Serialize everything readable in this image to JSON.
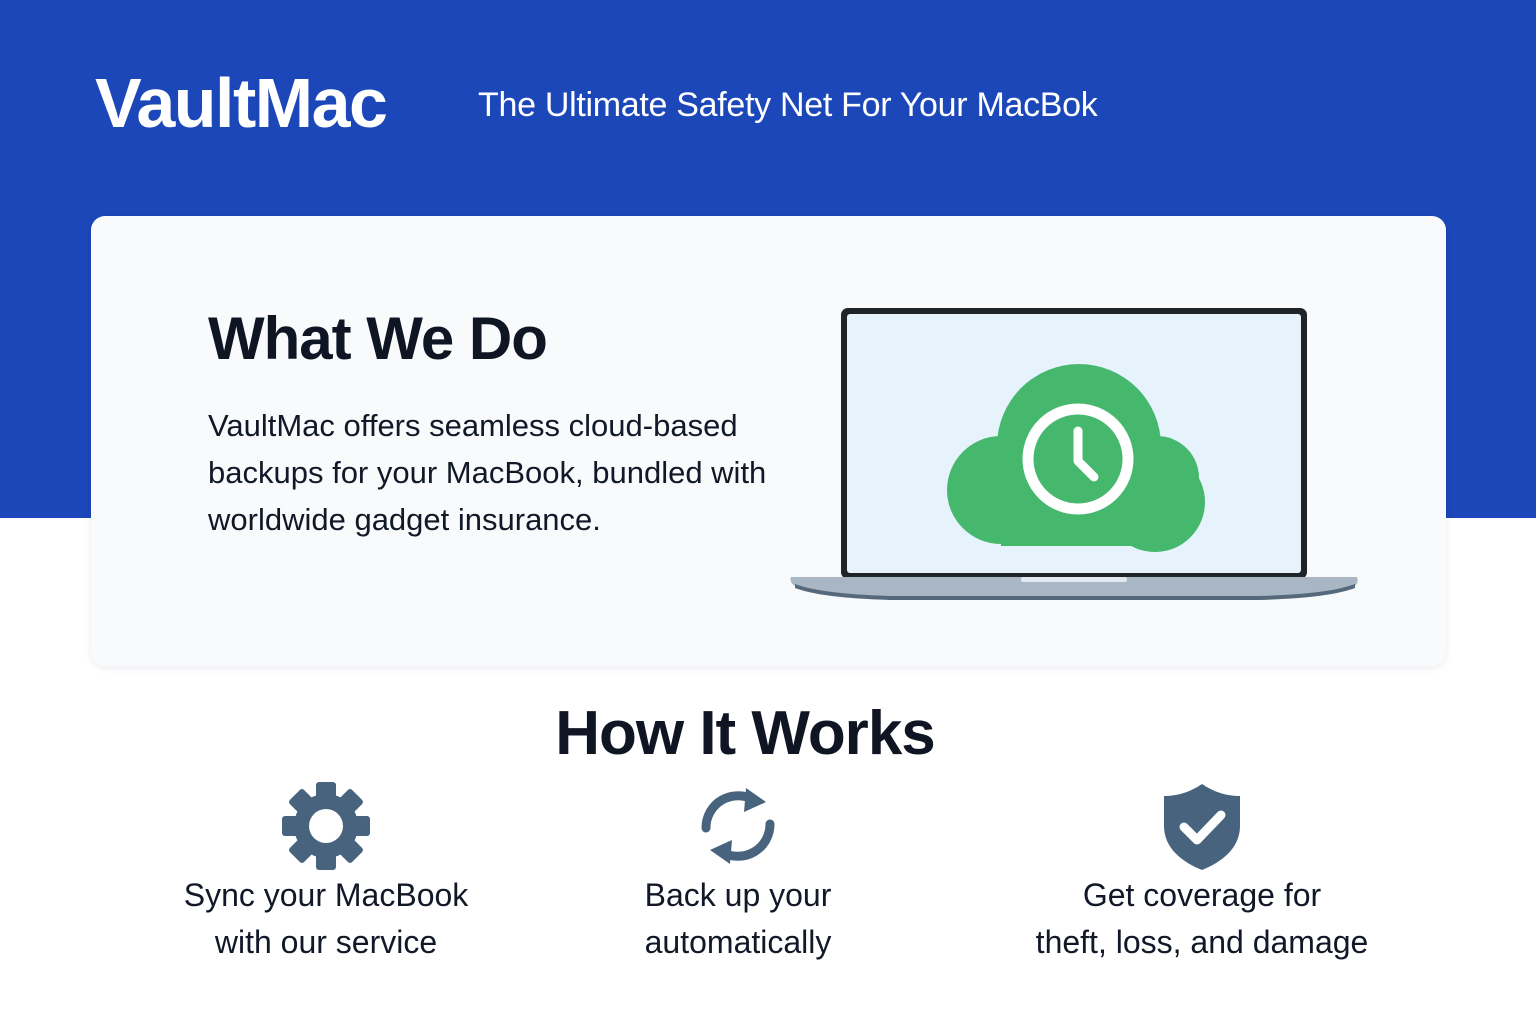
{
  "header": {
    "brand": "VaultMac",
    "tagline": "The Ultimate Safety Net For Your MacBok"
  },
  "about": {
    "title": "What We Do",
    "body": "VaultMac offers seamless cloud-based backups for your MacBook, bundled with worldwide gadget insurance.",
    "illustration": "laptop-cloud-clock-icon"
  },
  "how": {
    "title": "How It Works",
    "steps": [
      {
        "icon": "gear-icon",
        "label": "Sync your MacBook\nwith our service"
      },
      {
        "icon": "sync-arrows-icon",
        "label": "Back up your\nautomatically"
      },
      {
        "icon": "shield-check-icon",
        "label": "Get coverage for\ntheft, loss, and damage"
      }
    ]
  },
  "colors": {
    "brand_blue": "#1c47b8",
    "cloud_green": "#45b86e",
    "icon_slate": "#47637e",
    "text_dark": "#0f1523"
  }
}
